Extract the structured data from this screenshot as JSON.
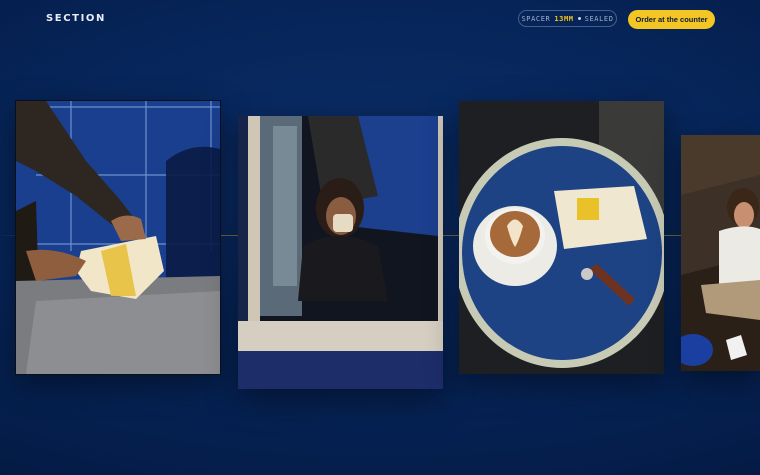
{
  "header": {
    "logo": "SECTION",
    "pill": {
      "label": "SPACER",
      "value": "13MM",
      "status": "SEALED"
    },
    "cta_label": "Order at the counter"
  },
  "colors": {
    "background": "#062457",
    "accent": "#f3c624",
    "text": "#e9eef9"
  },
  "gallery": {
    "photos": [
      {
        "subject": "hands-wrapping-sandwich-photo"
      },
      {
        "subject": "woman-eating-at-window-photo"
      },
      {
        "subject": "coffee-and-sandwich-table-photo"
      },
      {
        "subject": "smiling-woman-eating-photo"
      }
    ]
  }
}
